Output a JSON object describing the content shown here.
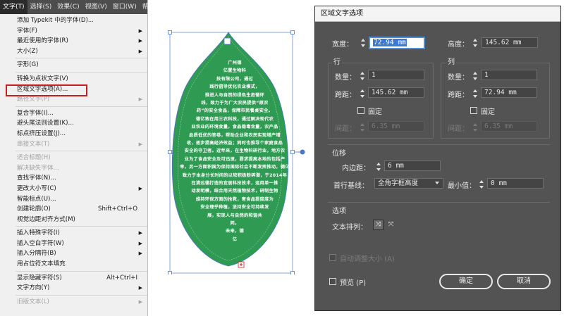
{
  "menubar": {
    "items": [
      "文字(T)",
      "选择(S)",
      "效果(C)",
      "视图(V)",
      "窗口(W)",
      "帮"
    ]
  },
  "menu": {
    "items": [
      {
        "label": "添加 Typekit 中的字体(D)...",
        "shortcut": "",
        "submenu": false,
        "disabled": false
      },
      {
        "label": "字体(F)",
        "shortcut": "",
        "submenu": true,
        "disabled": false
      },
      {
        "label": "最近使用的字体(R)",
        "shortcut": "",
        "submenu": true,
        "disabled": false
      },
      {
        "label": "大小(Z)",
        "shortcut": "",
        "submenu": true,
        "disabled": false
      },
      {
        "divider": true
      },
      {
        "label": "字形(G)",
        "shortcut": "",
        "submenu": false,
        "disabled": false
      },
      {
        "divider": true
      },
      {
        "label": "转换为点状文字(V)",
        "shortcut": "",
        "submenu": false,
        "disabled": false
      },
      {
        "label": "区域文字选项(A)...",
        "shortcut": "",
        "submenu": false,
        "disabled": false
      },
      {
        "label": "路径文字(P)",
        "shortcut": "",
        "submenu": true,
        "disabled": true
      },
      {
        "divider": true
      },
      {
        "label": "复合字体(I)...",
        "shortcut": "",
        "submenu": false,
        "disabled": false
      },
      {
        "label": "避头尾法则设置(K)...",
        "shortcut": "",
        "submenu": false,
        "disabled": false
      },
      {
        "label": "标点挤压设置(J)...",
        "shortcut": "",
        "submenu": false,
        "disabled": false
      },
      {
        "label": "串接文本(T)",
        "shortcut": "",
        "submenu": true,
        "disabled": true
      },
      {
        "divider": true
      },
      {
        "label": "适合标题(H)",
        "shortcut": "",
        "submenu": false,
        "disabled": true
      },
      {
        "label": "解决缺失字体...",
        "shortcut": "",
        "submenu": false,
        "disabled": true
      },
      {
        "label": "查找字体(N)...",
        "shortcut": "",
        "submenu": false,
        "disabled": false
      },
      {
        "label": "更改大小写(C)",
        "shortcut": "",
        "submenu": true,
        "disabled": false
      },
      {
        "label": "智能标点(U)...",
        "shortcut": "",
        "submenu": false,
        "disabled": false
      },
      {
        "label": "创建轮廓(O)",
        "shortcut": "Shift+Ctrl+O",
        "submenu": false,
        "disabled": false
      },
      {
        "label": "视觉边距对齐方式(M)",
        "shortcut": "",
        "submenu": false,
        "disabled": false
      },
      {
        "divider": true
      },
      {
        "label": "插入特殊字符(I)",
        "shortcut": "",
        "submenu": true,
        "disabled": false
      },
      {
        "label": "插入空白字符(W)",
        "shortcut": "",
        "submenu": true,
        "disabled": false
      },
      {
        "label": "插入分隔符(B)",
        "shortcut": "",
        "submenu": true,
        "disabled": false
      },
      {
        "label": "用占位符文本填充",
        "shortcut": "",
        "submenu": false,
        "disabled": false
      },
      {
        "divider": true
      },
      {
        "label": "显示隐藏字符(S)",
        "shortcut": "Alt+Ctrl+I",
        "submenu": false,
        "disabled": false
      },
      {
        "label": "文字方向(Y)",
        "shortcut": "",
        "submenu": true,
        "disabled": false
      },
      {
        "divider": true
      },
      {
        "label": "旧版文本(L)",
        "shortcut": "",
        "submenu": true,
        "disabled": true
      }
    ]
  },
  "leaf": {
    "fill_color": "#2e9a52",
    "lines": [
      "广州德",
      "亿置生物科",
      "技有限公司，通过",
      "践行倡导优化农业模式，",
      "推进人与自然的绿色生态循环",
      "线，致力于为广大农民提供“原农",
      "药”的安全食品，保障市民餐桌安全。",
      "德亿致在用三农科技，通过解决现代农",
      "业农业的环境食量，食品隐毒含量，农产品",
      "品质低优的答卷，帮助企业和农民实现增产增",
      "收，逐步提高经济效益；同时也推导个家庭食品",
      "安全的守卫者。近年来，在生物科研行业，地方农",
      "业为了食品安全及可迅速，要求提高本地的包括产",
      "率，另一方面积国为保持国际社会不断发挥推动，德亿",
      "致力于本身分长时间的以较积极粉碎潜，于2014年",
      "在清远德打造的宜居科技技术，运用单一推",
      "动发明模，结合用天然植物技术，研制生物",
      "维持环保方面的抢救，害食品提度度为",
      "安全理乎种植，坚持安全可持续发",
      "展，实现人与自然的和谐共",
      "同。",
      "未来，德",
      "亿"
    ]
  },
  "dialog": {
    "title": "区域文字选项",
    "width_label": "宽度：",
    "width_value": "72.94 mm",
    "height_label": "高度：",
    "height_value": "145.62 mm",
    "rows_label": "行",
    "cols_label": "列",
    "rows_count_label": "数量：",
    "rows_count": "1",
    "rows_span_label": "跨距：",
    "rows_span": "145.62 mm",
    "rows_fixed_label": "固定",
    "rows_gutter_label": "间距：",
    "rows_gutter": "6.35 mm",
    "cols_count_label": "数量：",
    "cols_count": "1",
    "cols_span_label": "跨距：",
    "cols_span": "72.94 mm",
    "cols_fixed_label": "固定",
    "cols_gutter_label": "间距：",
    "cols_gutter": "6.35 mm",
    "offset_label": "位移",
    "inset_label": "内边距：",
    "inset_value": "6 mm",
    "baseline_label": "首行基线：",
    "baseline_value": "全角字框高度",
    "min_label": "最小值：",
    "min_value": "0 mm",
    "options_label": "选项",
    "flow_label": "文本排列：",
    "autosize_label": "自动调整大小 (A)",
    "preview_label": "预览 (P)",
    "ok_label": "确定",
    "cancel_label": "取消"
  }
}
